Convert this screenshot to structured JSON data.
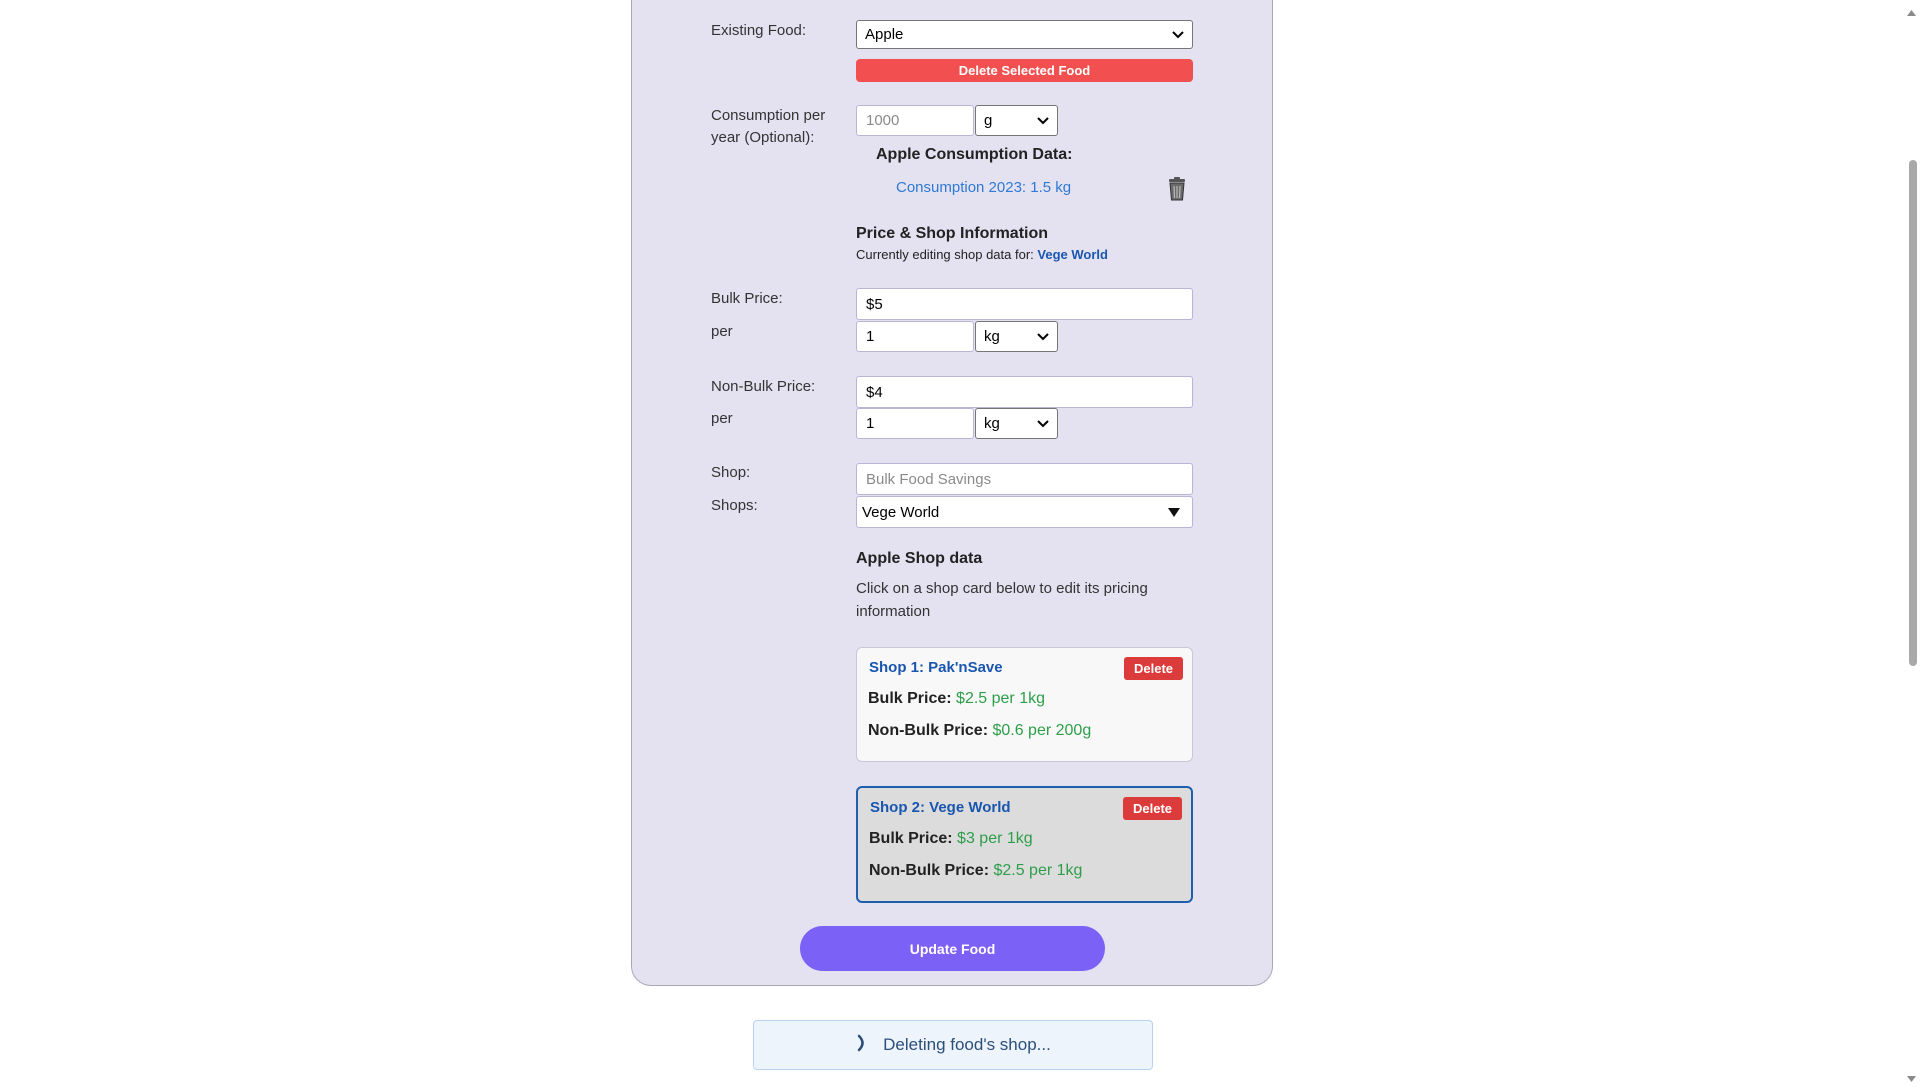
{
  "form": {
    "existing_food_label": "Existing Food:",
    "existing_food_value": "Apple",
    "delete_selected_label": "Delete Selected Food",
    "consumption_label_line1": "Consumption per",
    "consumption_label_line2": "year (Optional):",
    "consumption_placeholder": "1000",
    "consumption_unit": "g",
    "consumption_data_heading": "Apple Consumption Data:",
    "consumption_entry": "Consumption 2023: 1.5 kg",
    "price_shop_heading": "Price & Shop Information",
    "editing_prefix": "Currently editing shop data for:",
    "editing_shop": "Vege World",
    "bulk_price_label": "Bulk Price:",
    "bulk_price_value": "$5",
    "per_label": "per",
    "bulk_qty": "1",
    "bulk_unit": "kg",
    "nonbulk_price_label": "Non-Bulk Price:",
    "nonbulk_price_value": "$4",
    "nonbulk_qty": "1",
    "nonbulk_unit": "kg",
    "shop_label": "Shop:",
    "shop_placeholder": "Bulk Food Savings",
    "shops_label": "Shops:",
    "shops_value": "Vege World",
    "shop_data_heading": "Apple Shop data",
    "shop_data_hint_line1": "Click on a shop card below to edit its pricing",
    "shop_data_hint_line2": "information",
    "update_label": "Update Food"
  },
  "shops": [
    {
      "title": "Shop 1: Pak'nSave",
      "delete_label": "Delete",
      "bulk_label": "Bulk Price:",
      "bulk_value": "$2.5 per 1kg",
      "nonbulk_label": "Non-Bulk Price:",
      "nonbulk_value": "$0.6 per 200g"
    },
    {
      "title": "Shop 2: Vege World",
      "delete_label": "Delete",
      "bulk_label": "Bulk Price:",
      "bulk_value": "$3 per 1kg",
      "nonbulk_label": "Non-Bulk Price:",
      "nonbulk_value": "$2.5 per 1kg"
    }
  ],
  "status": {
    "message": "Deleting food's shop..."
  },
  "icons": [
    "chevron-down-icon",
    "trash-icon",
    "spinner-icon",
    "triangle-down-icon"
  ],
  "colors": {
    "accent": "#7b61f5",
    "danger": "#f25050",
    "link": "#1a56b0",
    "price": "#2e9e4a"
  }
}
